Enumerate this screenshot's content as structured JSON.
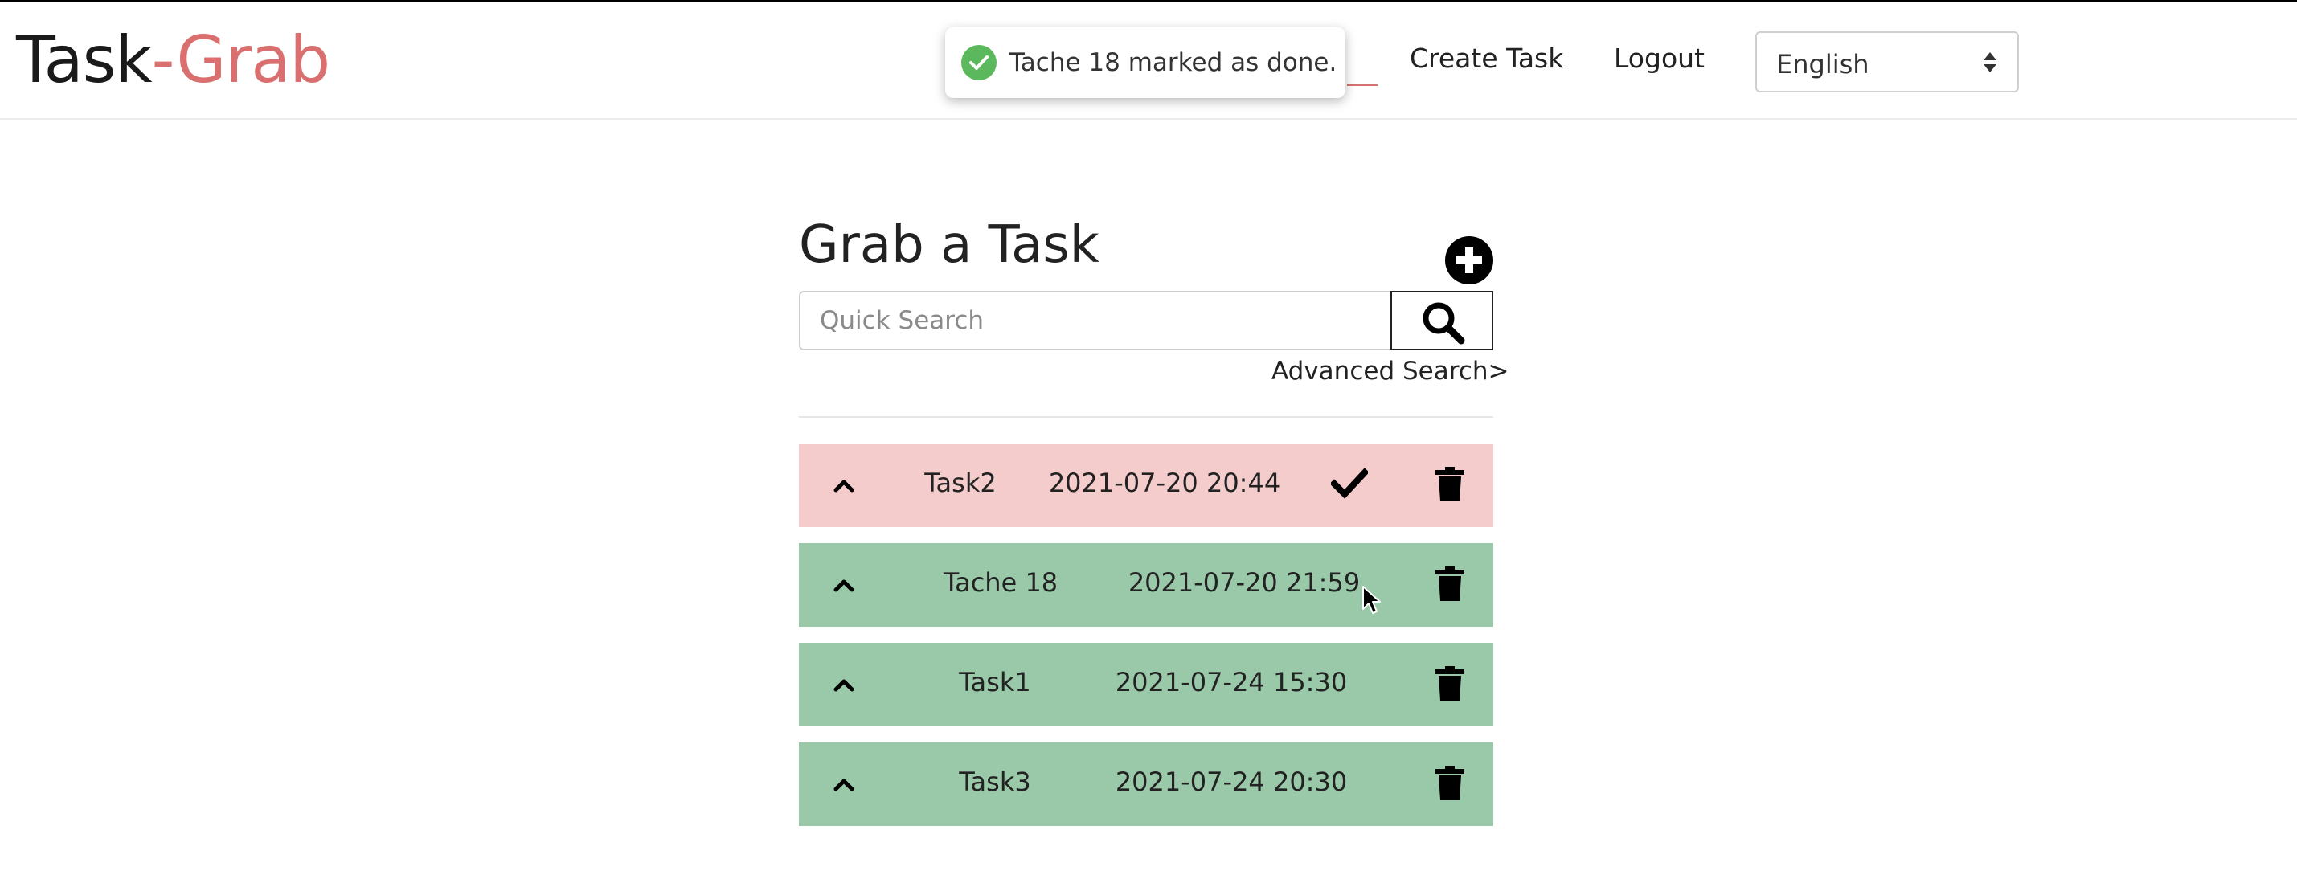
{
  "brand": {
    "part1": "Task",
    "part2": "-Grab"
  },
  "nav": {
    "create_task": "Create Task",
    "logout": "Logout"
  },
  "language": {
    "selected": "English"
  },
  "toast": {
    "message": "Tache 18 marked as done."
  },
  "main": {
    "title": "Grab a Task",
    "search_placeholder": "Quick Search",
    "advanced_search": "Advanced Search>"
  },
  "tasks": [
    {
      "name": "Task2",
      "date": "2021-07-20 20:44",
      "status": "pending"
    },
    {
      "name": "Tache 18",
      "date": "2021-07-20 21:59",
      "status": "done"
    },
    {
      "name": "Task1",
      "date": "2021-07-24 15:30",
      "status": "done"
    },
    {
      "name": "Task3",
      "date": "2021-07-24 20:30",
      "status": "done"
    }
  ],
  "colors": {
    "brand_accent": "#d9706f",
    "pending_row": "#f5cccc",
    "done_row": "#99c9a8",
    "toast_success": "#5cb85c"
  },
  "icons": [
    "check-circle-icon",
    "plus-circle-icon",
    "search-icon",
    "chevron-up-icon",
    "check-icon",
    "trash-icon",
    "mouse-cursor-icon"
  ]
}
